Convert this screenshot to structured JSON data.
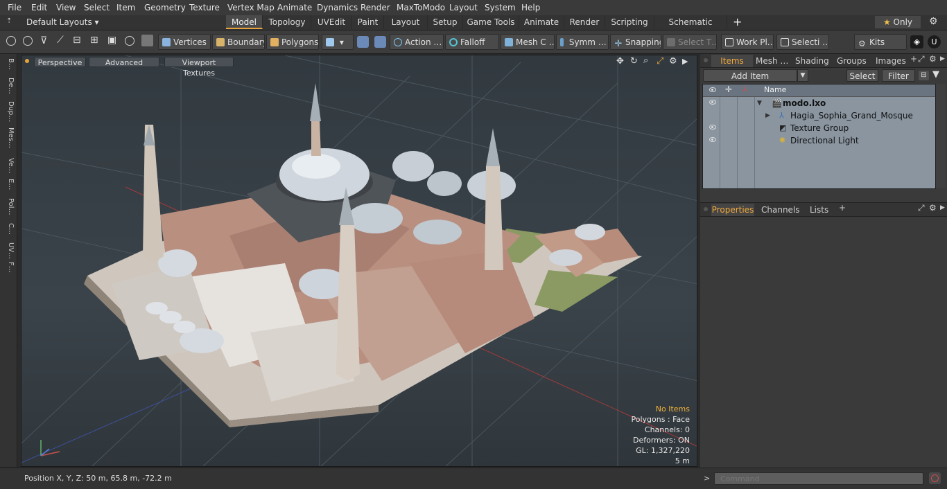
{
  "menu": [
    "File",
    "Edit",
    "View",
    "Select",
    "Item",
    "Geometry",
    "Texture",
    "Vertex Map",
    "Animate",
    "Dynamics",
    "Render",
    "MaxToModo",
    "Layout",
    "System",
    "Help"
  ],
  "layouts": {
    "label": "Default Layouts"
  },
  "layout_tabs": {
    "items": [
      "Model",
      "Topology",
      "UVEdit",
      "Paint",
      "Layout",
      "Setup",
      "Game Tools",
      "Animate",
      "Render",
      "Scripting",
      "Schematic Fusion"
    ],
    "active": "Model",
    "only_label": "Only"
  },
  "toolbar": {
    "vertices": "Vertices",
    "boundary": "Boundary",
    "polygons": "Polygons",
    "action": "Action …",
    "falloff": "Falloff",
    "mesh": "Mesh C …",
    "symm": "Symm …",
    "snapping": "Snapping",
    "select_t": "Select T…",
    "work_pl": "Work Pl…",
    "selecti": "Selecti …",
    "kits": "Kits"
  },
  "left_strip": [
    "B…",
    "De…",
    "Dup…",
    "Mes…",
    "Ve…",
    "E…",
    "Pol…",
    "C…",
    "UV…",
    "F…"
  ],
  "viewport": {
    "perspective": "Perspective",
    "advanced": "Advanced",
    "textures": "Viewport Textures",
    "no_items": "No Items",
    "polygons": "Polygons : Face",
    "channels": "Channels: 0",
    "deformers": "Deformers: ON",
    "gl": "GL: 1,327,220",
    "scale": "5 m"
  },
  "status": {
    "position": "Position X, Y, Z:   50 m, 65.8 m, -72.2 m"
  },
  "items_panel": {
    "tabs": [
      "Items",
      "Mesh …",
      "Shading",
      "Groups",
      "Images"
    ],
    "add_item": "Add Item",
    "select": "Select",
    "filter": "Filter",
    "name_header": "Name",
    "tree": [
      {
        "name": "modo.lxo"
      },
      {
        "name": "Hagia_Sophia_Grand_Mosque"
      },
      {
        "name": "Texture Group"
      },
      {
        "name": "Directional Light"
      }
    ]
  },
  "properties_panel": {
    "tabs": [
      "Properties",
      "Channels",
      "Lists"
    ]
  },
  "command": {
    "placeholder": "Command"
  },
  "colors": {
    "accent": "#e8a33c",
    "panel": "#3a3a3a",
    "viewport": "#353d44"
  }
}
